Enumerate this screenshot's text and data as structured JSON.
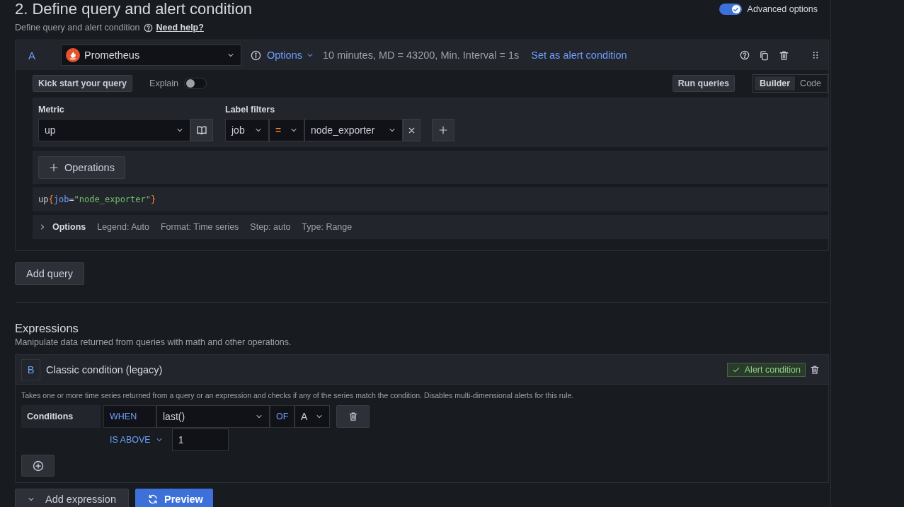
{
  "header": {
    "title": "2. Define query and alert condition",
    "subtitle": "Define query and alert condition",
    "help_link": "Need help?",
    "advanced_toggle": {
      "label": "Advanced options",
      "on": true
    }
  },
  "query": {
    "ref": "A",
    "datasource": "Prometheus",
    "options_link": "Options",
    "options_summary": "10 minutes, MD = 43200, Min. Interval = 1s",
    "set_alert": "Set as alert condition",
    "kick_start": "Kick start your query",
    "explain": {
      "label": "Explain",
      "on": false
    },
    "run_queries": "Run queries",
    "modes": [
      {
        "label": "Builder",
        "selected": true
      },
      {
        "label": "Code",
        "selected": false
      }
    ],
    "metric_label": "Metric",
    "metric": "up",
    "label_filters_label": "Label filters",
    "filter": {
      "label": "job",
      "operator": "=",
      "value": "node_exporter"
    },
    "operations": "Operations",
    "code": [
      {
        "kind": "metric",
        "text": "up"
      },
      {
        "kind": "brace",
        "text": "{"
      },
      {
        "kind": "label",
        "text": "job"
      },
      {
        "kind": "operator",
        "text": "="
      },
      {
        "kind": "string",
        "text": "\"node_exporter\""
      },
      {
        "kind": "brace",
        "text": "}"
      }
    ],
    "options": {
      "label": "Options",
      "expanded": false,
      "items": [
        "Legend: Auto",
        "Format: Time series",
        "Step: auto",
        "Type: Range"
      ]
    }
  },
  "add_query": "Add query",
  "expressions": {
    "title": "Expressions",
    "subtitle": "Manipulate data returned from queries with math and other operations.",
    "items": [
      {
        "ref": "B",
        "title": "Classic condition (legacy)",
        "alert_condition": true,
        "alert_condition_label": "Alert condition",
        "description": "Takes one or more time series returned from a query or an expression and checks if any of the series match the condition. Disables multi-dimensional alerts for this rule.",
        "conditions_label": "Conditions",
        "when": "WHEN",
        "reducer": "last()",
        "of": "OF",
        "query": "A",
        "evaluator": "IS ABOVE",
        "threshold": "1"
      }
    ]
  },
  "footer": {
    "add_expression": "Add expression",
    "preview": "Preview"
  }
}
